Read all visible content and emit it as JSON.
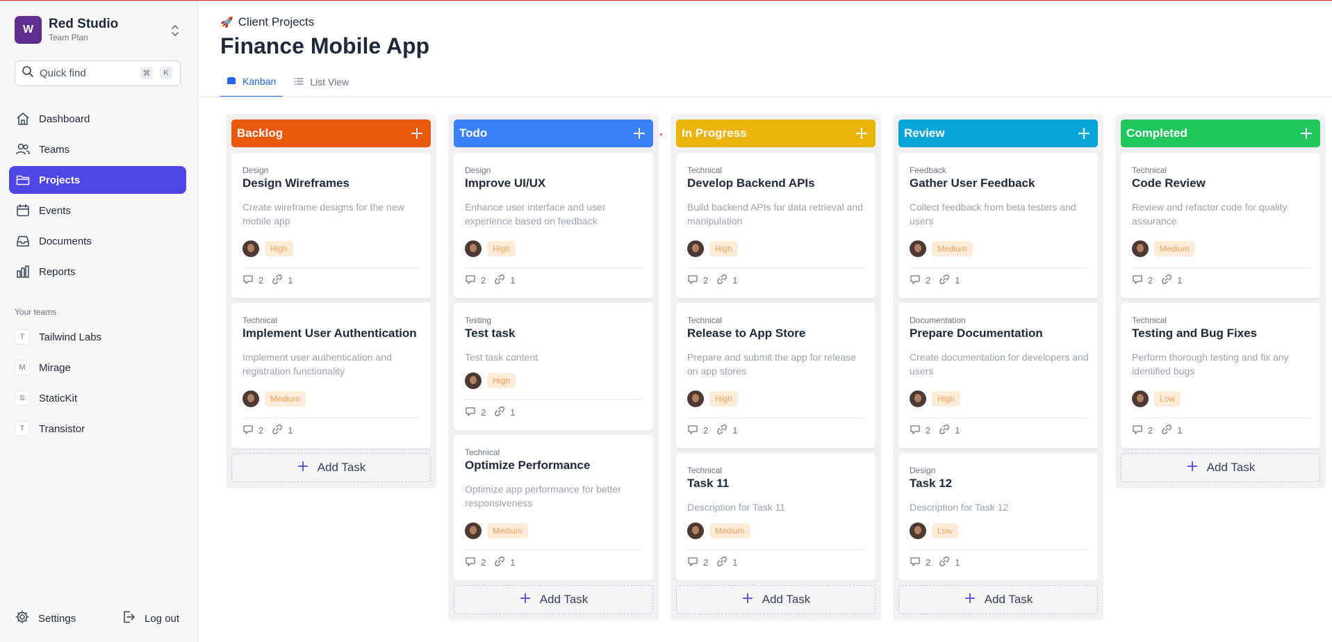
{
  "workspace": {
    "initial": "W",
    "name": "Red Studio",
    "plan": "Team Plan"
  },
  "search": {
    "placeholder": "Quick find",
    "kbd1": "⌘",
    "kbd2": "K"
  },
  "nav": [
    {
      "label": "Dashboard",
      "icon": "home-icon"
    },
    {
      "label": "Teams",
      "icon": "users-icon"
    },
    {
      "label": "Projects",
      "icon": "folder-icon",
      "active": true
    },
    {
      "label": "Events",
      "icon": "calendar-icon"
    },
    {
      "label": "Documents",
      "icon": "inbox-icon"
    },
    {
      "label": "Reports",
      "icon": "chart-icon"
    }
  ],
  "teams_heading": "Your teams",
  "teams": [
    {
      "initial": "T",
      "label": "Tailwind Labs"
    },
    {
      "initial": "M",
      "label": "Mirage"
    },
    {
      "initial": "S",
      "label": "StaticKit"
    },
    {
      "initial": "T",
      "label": "Transistor"
    }
  ],
  "footer": {
    "settings": "Settings",
    "logout": "Log out"
  },
  "header": {
    "crumb": "Client Projects",
    "title": "Finance Mobile App"
  },
  "tabs": [
    {
      "label": "Kanban",
      "active": true
    },
    {
      "label": "List View"
    }
  ],
  "colors": {
    "backlog": "#ea580c",
    "todo": "#3b82f6",
    "in_progress": "#eab308",
    "review": "#06a5d6",
    "completed": "#22c55e",
    "accent": "#4f46e5"
  },
  "add_task_label": "Add Task",
  "columns": [
    {
      "title": "Backlog",
      "cards": [
        {
          "category": "Design",
          "title": "Design Wireframes",
          "description": "Create wireframe designs for the new mobile app",
          "priority": "High",
          "comments": "2",
          "links": "1"
        },
        {
          "category": "Technical",
          "title": "Implement User Authentication",
          "description": "Implement user authentication and registration functionality",
          "priority": "Medium",
          "comments": "2",
          "links": "1"
        }
      ]
    },
    {
      "title": "Todo",
      "cards": [
        {
          "category": "Design",
          "title": "Improve UI/UX",
          "description": "Enhance user interface and user experience based on feedback",
          "priority": "High",
          "comments": "2",
          "links": "1"
        },
        {
          "category": "Testing",
          "title": "Test task",
          "description": "Test task content",
          "priority": "High",
          "comments": "2",
          "links": "1"
        },
        {
          "category": "Technical",
          "title": "Optimize Performance",
          "description": "Optimize app performance for better responsiveness",
          "priority": "Medium",
          "comments": "2",
          "links": "1"
        }
      ]
    },
    {
      "title": "In Progress",
      "cards": [
        {
          "category": "Technical",
          "title": "Develop Backend APIs",
          "description": "Build backend APIs for data retrieval and manipulation",
          "priority": "High",
          "comments": "2",
          "links": "1"
        },
        {
          "category": "Technical",
          "title": "Release to App Store",
          "description": "Prepare and submit the app for release on app stores",
          "priority": "High",
          "comments": "2",
          "links": "1"
        },
        {
          "category": "Technical",
          "title": "Task 11",
          "description": "Description for Task 11",
          "priority": "Medium",
          "comments": "2",
          "links": "1"
        }
      ]
    },
    {
      "title": "Review",
      "cards": [
        {
          "category": "Feedback",
          "title": "Gather User Feedback",
          "description": "Collect feedback from beta testers and users",
          "priority": "Medium",
          "comments": "2",
          "links": "1"
        },
        {
          "category": "Documentation",
          "title": "Prepare Documentation",
          "description": "Create documentation for developers and users",
          "priority": "High",
          "comments": "2",
          "links": "1"
        },
        {
          "category": "Design",
          "title": "Task 12",
          "description": "Description for Task 12",
          "priority": "Low",
          "comments": "2",
          "links": "1"
        }
      ]
    },
    {
      "title": "Completed",
      "cards": [
        {
          "category": "Technical",
          "title": "Code Review",
          "description": "Review and refactor code for quality assurance",
          "priority": "Medium",
          "comments": "2",
          "links": "1"
        },
        {
          "category": "Technical",
          "title": "Testing and Bug Fixes",
          "description": "Perform thorough testing and fix any identified bugs",
          "priority": "Low",
          "comments": "2",
          "links": "1"
        }
      ]
    }
  ]
}
